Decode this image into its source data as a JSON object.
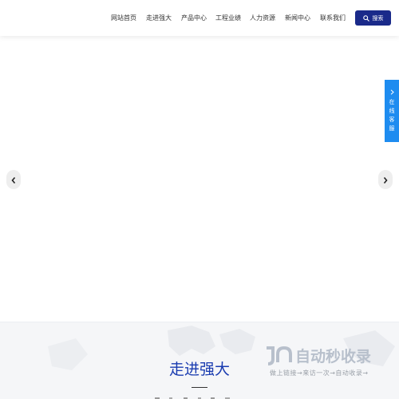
{
  "nav": {
    "items": [
      {
        "label": "网站首页"
      },
      {
        "label": "走进强大"
      },
      {
        "label": "产品中心"
      },
      {
        "label": "工程业绩"
      },
      {
        "label": "人力资源"
      },
      {
        "label": "新闻中心"
      },
      {
        "label": "联系我们"
      }
    ],
    "search_label": "搜索"
  },
  "banner": {
    "prev_icon": "chevron-left-icon",
    "next_icon": "chevron-right-icon"
  },
  "service": {
    "chars": [
      "在",
      "线",
      "客",
      "服"
    ]
  },
  "section": {
    "title": "走进强大"
  },
  "watermark": {
    "brand": "自动秒收录",
    "tagline": "做上链接→来访一次→自动收录→"
  },
  "colors": {
    "nav_text": "#333333",
    "search_bg": "#1a2a8a",
    "service_bg": "#1e8cf0",
    "title_color": "#1a3cb0"
  }
}
